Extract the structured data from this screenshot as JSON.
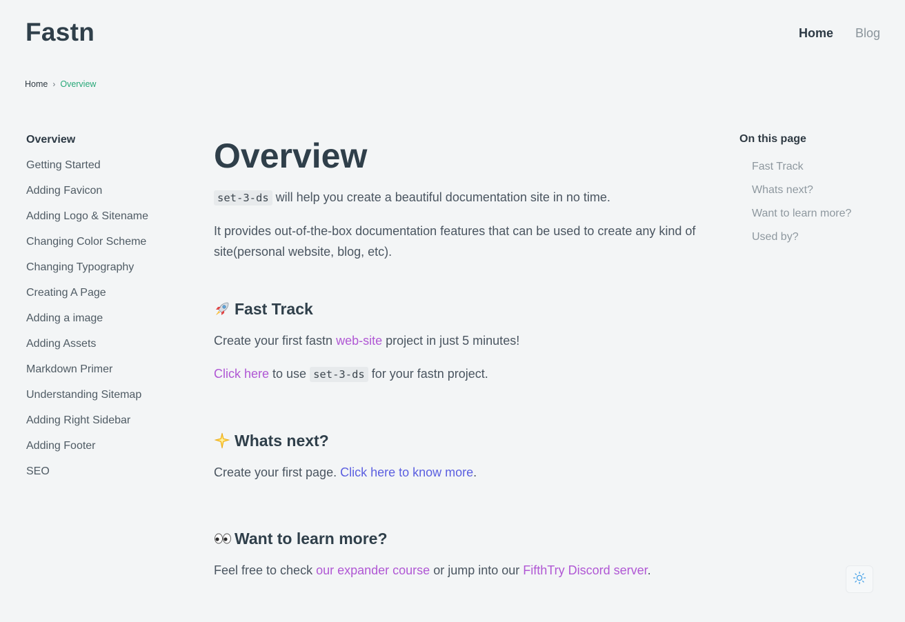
{
  "header": {
    "logo": "Fastn",
    "nav": [
      {
        "label": "Home",
        "active": true
      },
      {
        "label": "Blog",
        "active": false
      }
    ]
  },
  "breadcrumb": {
    "home": "Home",
    "separator": "›",
    "current": "Overview"
  },
  "sidebar": {
    "items": [
      {
        "label": "Overview",
        "current": true
      },
      {
        "label": "Getting Started"
      },
      {
        "label": "Adding Favicon"
      },
      {
        "label": "Adding Logo & Sitename"
      },
      {
        "label": "Changing Color Scheme"
      },
      {
        "label": "Changing Typography"
      },
      {
        "label": "Creating A Page"
      },
      {
        "label": "Adding a image"
      },
      {
        "label": "Adding Assets"
      },
      {
        "label": "Markdown Primer"
      },
      {
        "label": "Understanding Sitemap"
      },
      {
        "label": "Adding Right Sidebar"
      },
      {
        "label": "Adding Footer"
      },
      {
        "label": "SEO"
      }
    ]
  },
  "main": {
    "title": "Overview",
    "intro": {
      "code": "set-3-ds",
      "text": " will help you create a beautiful documentation site in no time."
    },
    "description": "It provides out-of-the-box documentation features that can be used to create any kind of site(personal website, blog, etc).",
    "fast_track": {
      "icon": "rocket-icon",
      "title": "Fast Track",
      "line1_pre": "Create your first fastn ",
      "line1_link": "web-site",
      "line1_post": " project in just 5 minutes!",
      "line2_link": "Click here",
      "line2_mid": " to use ",
      "line2_code": "set-3-ds",
      "line2_post": " for your fastn project."
    },
    "whats_next": {
      "icon": "star-icon",
      "title": "Whats next?",
      "pre": "Create your first page. ",
      "link": "Click here to know more",
      "post": "."
    },
    "learn_more": {
      "icon": "eyes-icon",
      "title": "Want to learn more?",
      "pre": "Feel free to check ",
      "link1": "our expander course",
      "mid": " or jump into our ",
      "link2": "FifthTry Discord server",
      "post": "."
    }
  },
  "toc": {
    "title": "On this page",
    "items": [
      "Fast Track",
      "Whats next?",
      "Want to learn more?",
      "Used by?"
    ]
  },
  "theme_toggle": {
    "icon": "sun-icon"
  },
  "colors": {
    "background": "#f3f5f6",
    "heading": "#2f3f4a",
    "link_purple": "#b057d4",
    "link_blue": "#5b5fe0",
    "breadcrumb_active": "#27a878"
  }
}
